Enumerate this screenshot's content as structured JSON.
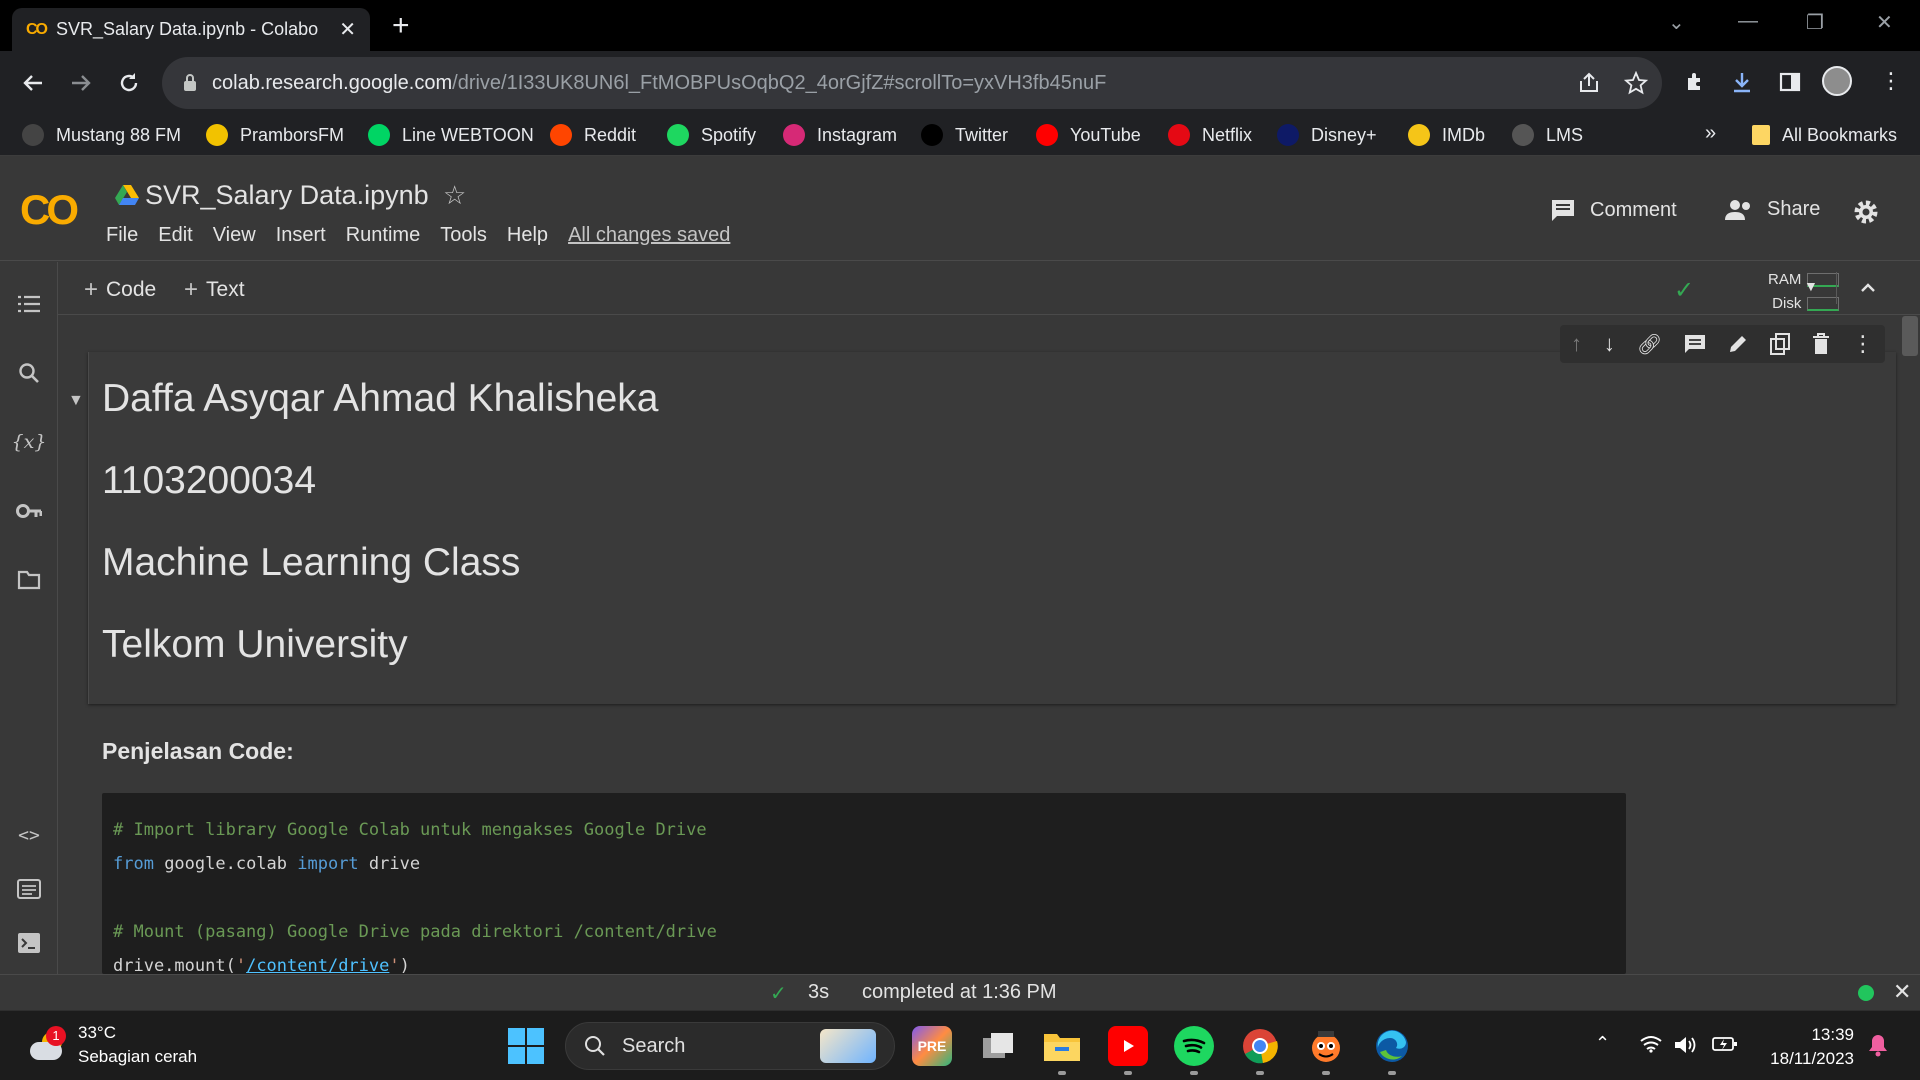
{
  "browser": {
    "tab_title": "SVR_Salary Data.ipynb - Colabor",
    "url_host": "colab.research.google.com",
    "url_path": "/drive/1I33UK8UN6l_FtMOBPUsOqbQ2_4orGjfZ#scrollTo=yxVH3fb45nuF",
    "bookmarks": [
      {
        "label": "Mustang 88 FM",
        "icon": "radio-icon",
        "color": "#444444"
      },
      {
        "label": "PramborsFM",
        "icon": "prambors-icon",
        "color": "#f2c200"
      },
      {
        "label": "Line WEBTOON",
        "icon": "webtoon-icon",
        "color": "#00d564"
      },
      {
        "label": "Reddit",
        "icon": "reddit-icon",
        "color": "#ff4500"
      },
      {
        "label": "Spotify",
        "icon": "spotify-icon",
        "color": "#1ed760"
      },
      {
        "label": "Instagram",
        "icon": "instagram-icon",
        "color": "#d62976"
      },
      {
        "label": "Twitter",
        "icon": "x-icon",
        "color": "#000000"
      },
      {
        "label": "YouTube",
        "icon": "youtube-icon",
        "color": "#ff0000"
      },
      {
        "label": "Netflix",
        "icon": "netflix-icon",
        "color": "#e50914"
      },
      {
        "label": "Disney+",
        "icon": "disney-icon",
        "color": "#0e1a66"
      },
      {
        "label": "IMDb",
        "icon": "imdb-icon",
        "color": "#f5c518"
      },
      {
        "label": "LMS",
        "icon": "lms-icon",
        "color": "#555555"
      }
    ],
    "overflow": "»",
    "all_bookmarks": "All Bookmarks"
  },
  "colab": {
    "logo": "CO",
    "notebook_title": "SVR_Salary Data.ipynb",
    "menu": [
      "File",
      "Edit",
      "View",
      "Insert",
      "Runtime",
      "Tools",
      "Help"
    ],
    "save_status": "All changes saved",
    "comment_label": "Comment",
    "share_label": "Share",
    "add_code": "Code",
    "add_text": "Text",
    "ram_label": "RAM",
    "disk_label": "Disk"
  },
  "notebook": {
    "text_cell_lines": [
      "Daffa Asyqar Ahmad Khalisheka",
      "1103200034",
      "Machine Learning Class",
      "Telkom University"
    ],
    "section_heading": "Penjelasan Code:",
    "code": {
      "comment1": "# Import library Google Colab untuk mengakses Google Drive",
      "kw_from": "from",
      "module": " google.colab ",
      "kw_import": "import",
      "name": " drive",
      "comment2": "# Mount (pasang) Google Drive pada direktori /content/drive",
      "call": "drive.mount(",
      "quote_open": "'",
      "path": "/content/drive",
      "quote_close": "'",
      "close": ")"
    }
  },
  "status": {
    "duration": "3s",
    "message": "completed at 1:36 PM",
    "connected_color": "#21c55d"
  },
  "taskbar": {
    "temperature": "33°C",
    "weather": "Sebagian cerah",
    "weather_badge": "1",
    "search_placeholder": "Search",
    "time": "13:39",
    "date": "18/11/2023"
  }
}
